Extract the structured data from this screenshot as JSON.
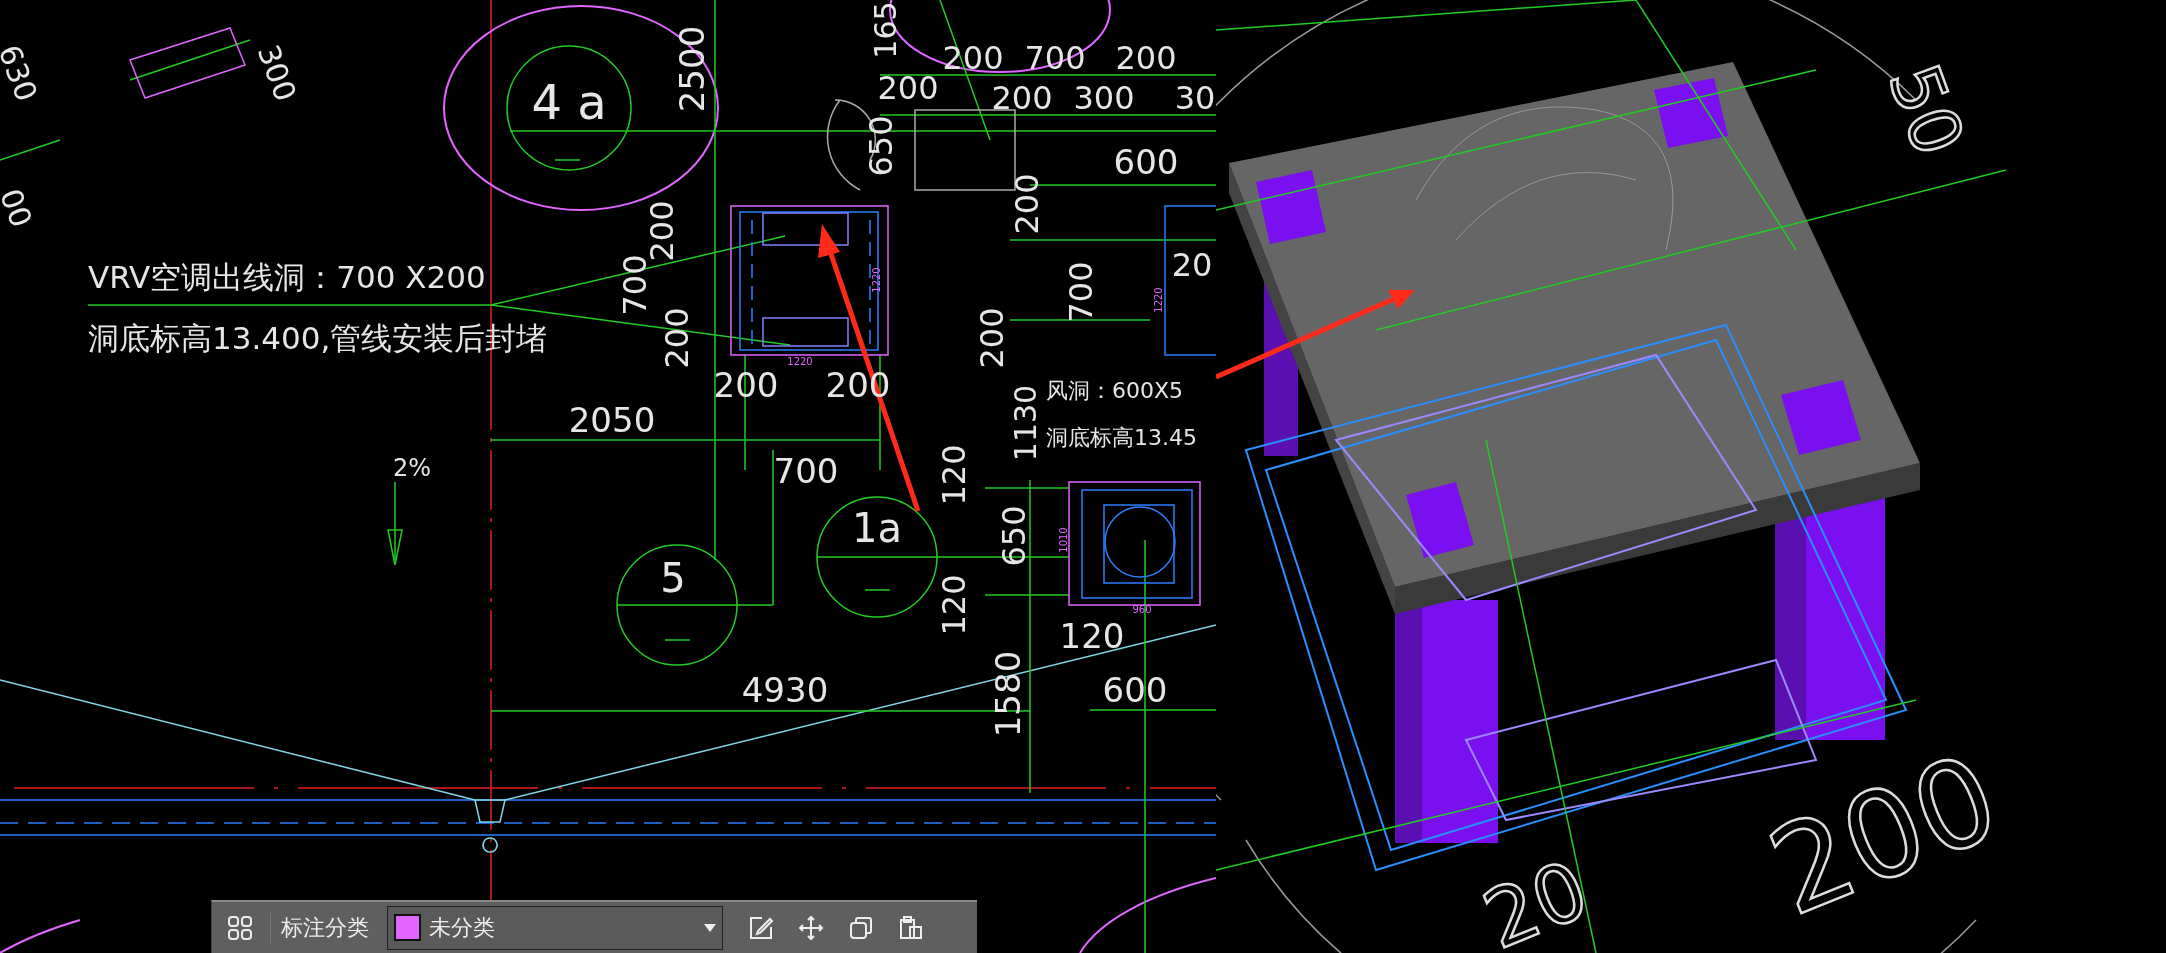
{
  "drawing": {
    "labels": [
      {
        "text": "VRV空调出线洞：700 X200"
      },
      {
        "text": "洞底标高13.400,管线安装后封堵"
      },
      {
        "text": "4 a"
      },
      {
        "text": "2500"
      },
      {
        "text": "2050"
      },
      {
        "text": "200"
      },
      {
        "text": "200"
      },
      {
        "text": "700"
      },
      {
        "text": "200"
      },
      {
        "text": "700"
      },
      {
        "text": "200"
      },
      {
        "text": "风洞：600X5"
      },
      {
        "text": "洞底标高13.45"
      },
      {
        "text": "1a"
      },
      {
        "text": "5"
      },
      {
        "text": "4930"
      },
      {
        "text": "2%"
      },
      {
        "text": "120"
      },
      {
        "text": "650"
      },
      {
        "text": "120"
      },
      {
        "text": "120"
      },
      {
        "text": "1580"
      },
      {
        "text": "600"
      },
      {
        "text": "1130"
      },
      {
        "text": "200"
      },
      {
        "text": "700"
      },
      {
        "text": "200"
      },
      {
        "text": "200"
      },
      {
        "text": "200"
      },
      {
        "text": "300"
      },
      {
        "text": "30"
      },
      {
        "text": "600"
      },
      {
        "text": "650"
      },
      {
        "text": "200"
      },
      {
        "text": "700"
      },
      {
        "text": "200"
      },
      {
        "text": "20"
      },
      {
        "text": "165"
      },
      {
        "text": "300"
      },
      {
        "text": "630"
      },
      {
        "text": "00"
      },
      {
        "text": "1220"
      },
      {
        "text": "1220"
      },
      {
        "text": "1010"
      },
      {
        "text": "960"
      },
      {
        "text": "1220"
      }
    ]
  },
  "view_3d": {
    "labels": [
      {
        "text": "200"
      },
      {
        "text": "20"
      },
      {
        "text": "50"
      }
    ]
  },
  "toolbar": {
    "title": "标注分类",
    "category": {
      "value": "未分类",
      "color": "#e066ff"
    }
  }
}
